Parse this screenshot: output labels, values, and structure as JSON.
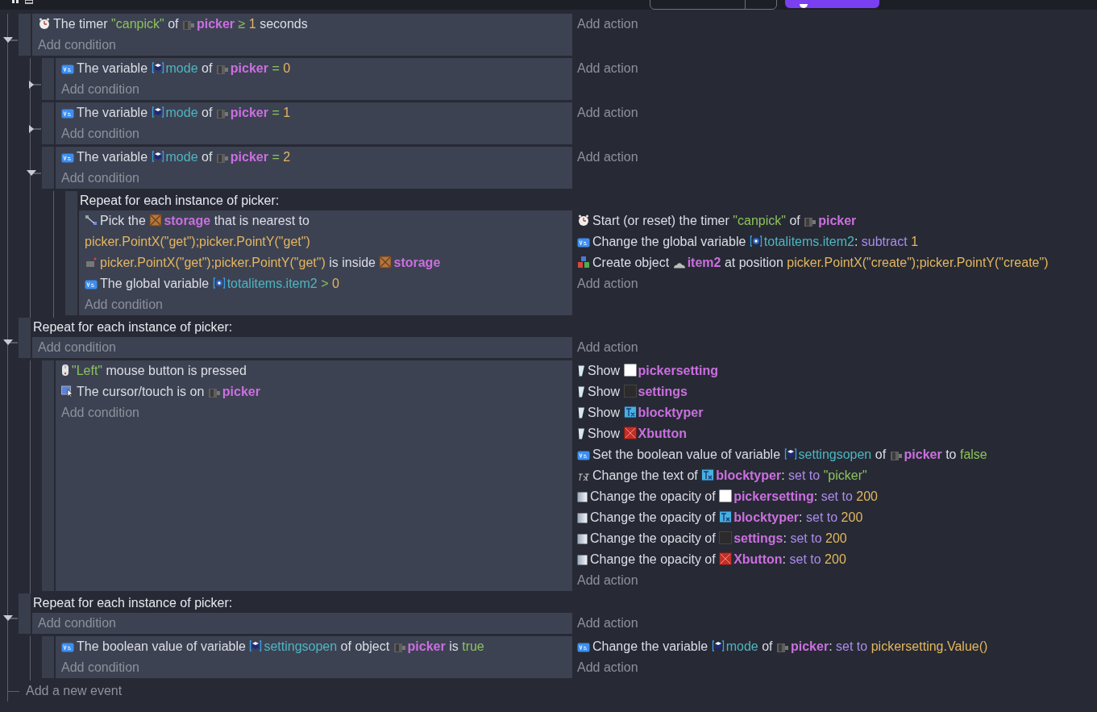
{
  "events": [
    {
      "kind": "standard",
      "expanded": true,
      "add_condition": "Add condition",
      "add_action": "Add action",
      "conditions": [
        {
          "kind": "timer",
          "parts": [
            {
              "kind": "text",
              "text": "The timer"
            },
            {
              "kind": "string",
              "text": "\"canpick\""
            },
            {
              "kind": "text",
              "text": "of"
            },
            {
              "kind": "sprite",
              "text": "picker"
            },
            {
              "kind": "operator",
              "text": "≥"
            },
            {
              "kind": "number",
              "text": "1"
            },
            {
              "kind": "text",
              "text": "seconds"
            }
          ]
        }
      ],
      "children": [
        {
          "kind": "standard",
          "expanded": false,
          "add_condition": "Add condition",
          "add_action": "Add action",
          "conditions": [
            {
              "kind": "variable",
              "parts": [
                {
                  "kind": "text",
                  "text": "The variable"
                },
                {
                  "kind": "objectvariable",
                  "text": "mode"
                },
                {
                  "kind": "text",
                  "text": "of"
                },
                {
                  "kind": "sprite",
                  "text": "picker"
                },
                {
                  "kind": "operator",
                  "text": "="
                },
                {
                  "kind": "number",
                  "text": "0"
                }
              ]
            }
          ]
        },
        {
          "kind": "standard",
          "expanded": false,
          "add_condition": "Add condition",
          "add_action": "Add action",
          "conditions": [
            {
              "kind": "variable",
              "parts": [
                {
                  "kind": "text",
                  "text": "The variable"
                },
                {
                  "kind": "objectvariable",
                  "text": "mode"
                },
                {
                  "kind": "text",
                  "text": "of"
                },
                {
                  "kind": "sprite",
                  "text": "picker"
                },
                {
                  "kind": "operator",
                  "text": "="
                },
                {
                  "kind": "number",
                  "text": "1"
                }
              ]
            }
          ]
        },
        {
          "kind": "standard",
          "expanded": true,
          "add_condition": "Add condition",
          "add_action": "Add action",
          "conditions": [
            {
              "kind": "variable",
              "parts": [
                {
                  "kind": "text",
                  "text": "The variable"
                },
                {
                  "kind": "objectvariable",
                  "text": "mode"
                },
                {
                  "kind": "text",
                  "text": "of"
                },
                {
                  "kind": "sprite",
                  "text": "picker"
                },
                {
                  "kind": "operator",
                  "text": "="
                },
                {
                  "kind": "number",
                  "text": "2"
                }
              ]
            }
          ],
          "children": [
            {
              "kind": "foreach",
              "header": "Repeat for each instance of picker:",
              "add_condition": "Add condition",
              "add_action": "Add action",
              "conditions": [
                {
                  "kind": "pick",
                  "parts": [
                    {
                      "kind": "text",
                      "text": "Pick the"
                    },
                    {
                      "kind": "crate",
                      "text": "storage"
                    },
                    {
                      "kind": "text",
                      "text": "that is nearest to"
                    },
                    {
                      "kind": "blockexpression",
                      "text": "picker.PointX(\"get\");picker.PointY(\"get\")"
                    }
                  ]
                },
                {
                  "kind": "point",
                  "parts": [
                    {
                      "kind": "expression",
                      "text": "picker.PointX(\"get\");picker.PointY(\"get\")"
                    },
                    {
                      "kind": "text",
                      "text": "is inside"
                    },
                    {
                      "kind": "crate",
                      "text": "storage"
                    }
                  ]
                },
                {
                  "kind": "variable",
                  "parts": [
                    {
                      "kind": "text",
                      "text": "The global variable"
                    },
                    {
                      "kind": "globalvariable",
                      "text": "totalitems.item2"
                    },
                    {
                      "kind": "operator",
                      "text": ">"
                    },
                    {
                      "kind": "number",
                      "text": "0"
                    }
                  ]
                }
              ],
              "actions": [
                {
                  "kind": "timer",
                  "parts": [
                    {
                      "kind": "text",
                      "text": "Start (or reset) the timer"
                    },
                    {
                      "kind": "string",
                      "text": "\"canpick\""
                    },
                    {
                      "kind": "text",
                      "text": "of"
                    },
                    {
                      "kind": "sprite",
                      "text": "picker"
                    }
                  ]
                },
                {
                  "kind": "variable",
                  "parts": [
                    {
                      "kind": "text",
                      "text": "Change the global variable"
                    },
                    {
                      "kind": "globalvariable",
                      "text": "totalitems.item2"
                    },
                    {
                      "kind": "colon",
                      "text": ":"
                    },
                    {
                      "kind": "keyword",
                      "text": "subtract"
                    },
                    {
                      "kind": "number",
                      "text": "1"
                    }
                  ]
                },
                {
                  "kind": "create",
                  "parts": [
                    {
                      "kind": "text",
                      "text": "Create object"
                    },
                    {
                      "kind": "cloud",
                      "text": "item2"
                    },
                    {
                      "kind": "text",
                      "text": "at position"
                    },
                    {
                      "kind": "expression",
                      "text": "picker.PointX(\"create\");picker.PointY(\"create\")"
                    }
                  ]
                }
              ]
            }
          ]
        }
      ]
    },
    {
      "kind": "foreach",
      "expanded": true,
      "header": "Repeat for each instance of picker:",
      "add_condition": "Add condition",
      "add_action": "Add action",
      "children": [
        {
          "kind": "standard",
          "add_condition": "Add condition",
          "add_action": "Add action",
          "conditions": [
            {
              "kind": "mouse",
              "parts": [
                {
                  "kind": "string",
                  "text": "\"Left\""
                },
                {
                  "kind": "text",
                  "text": "mouse button is pressed"
                }
              ]
            },
            {
              "kind": "cursor",
              "parts": [
                {
                  "kind": "text",
                  "text": "The cursor/touch is on"
                },
                {
                  "kind": "sprite",
                  "text": "picker"
                }
              ]
            }
          ],
          "actions": [
            {
              "kind": "show",
              "parts": [
                {
                  "kind": "text",
                  "text": "Show"
                },
                {
                  "kind": "panel",
                  "text": "pickersetting"
                }
              ]
            },
            {
              "kind": "show",
              "parts": [
                {
                  "kind": "text",
                  "text": "Show"
                },
                {
                  "kind": "darkpanel",
                  "text": "settings"
                }
              ]
            },
            {
              "kind": "show",
              "parts": [
                {
                  "kind": "text",
                  "text": "Show"
                },
                {
                  "kind": "textobject",
                  "text": "blocktyper"
                }
              ]
            },
            {
              "kind": "show",
              "parts": [
                {
                  "kind": "text",
                  "text": "Show"
                },
                {
                  "kind": "xbutton",
                  "text": "Xbutton"
                }
              ]
            },
            {
              "kind": "variable",
              "parts": [
                {
                  "kind": "text",
                  "text": "Set the boolean value of variable"
                },
                {
                  "kind": "objectvariable",
                  "text": "settingsopen"
                },
                {
                  "kind": "text",
                  "text": "of"
                },
                {
                  "kind": "sprite",
                  "text": "picker"
                },
                {
                  "kind": "text",
                  "text": "to"
                },
                {
                  "kind": "boolean",
                  "text": "false"
                }
              ]
            },
            {
              "kind": "textchange",
              "parts": [
                {
                  "kind": "text",
                  "text": "Change the text of"
                },
                {
                  "kind": "textobject",
                  "text": "blocktyper"
                },
                {
                  "kind": "colon",
                  "text": ":"
                },
                {
                  "kind": "keyword",
                  "text": "set to"
                },
                {
                  "kind": "string",
                  "text": "\"picker\""
                }
              ]
            },
            {
              "kind": "opacity",
              "parts": [
                {
                  "kind": "text",
                  "text": "Change the opacity of"
                },
                {
                  "kind": "panel",
                  "text": "pickersetting"
                },
                {
                  "kind": "colon",
                  "text": ":"
                },
                {
                  "kind": "keyword",
                  "text": "set to"
                },
                {
                  "kind": "number",
                  "text": "200"
                }
              ]
            },
            {
              "kind": "opacity",
              "parts": [
                {
                  "kind": "text",
                  "text": "Change the opacity of"
                },
                {
                  "kind": "textobject",
                  "text": "blocktyper"
                },
                {
                  "kind": "colon",
                  "text": ":"
                },
                {
                  "kind": "keyword",
                  "text": "set to"
                },
                {
                  "kind": "number",
                  "text": "200"
                }
              ]
            },
            {
              "kind": "opacity",
              "parts": [
                {
                  "kind": "text",
                  "text": "Change the opacity of"
                },
                {
                  "kind": "darkpanel",
                  "text": "settings"
                },
                {
                  "kind": "colon",
                  "text": ":"
                },
                {
                  "kind": "keyword",
                  "text": "set to"
                },
                {
                  "kind": "number",
                  "text": "200"
                }
              ]
            },
            {
              "kind": "opacity",
              "parts": [
                {
                  "kind": "text",
                  "text": "Change the opacity of"
                },
                {
                  "kind": "xbutton",
                  "text": "Xbutton"
                },
                {
                  "kind": "colon",
                  "text": ":"
                },
                {
                  "kind": "keyword",
                  "text": "set to"
                },
                {
                  "kind": "number",
                  "text": "200"
                }
              ]
            }
          ]
        }
      ]
    },
    {
      "kind": "foreach",
      "expanded": true,
      "header": "Repeat for each instance of picker:",
      "add_condition": "Add condition",
      "add_action": "Add action",
      "children": [
        {
          "kind": "standard",
          "add_condition": "Add condition",
          "add_action": "Add action",
          "conditions": [
            {
              "kind": "variable",
              "parts": [
                {
                  "kind": "text",
                  "text": "The boolean value of variable"
                },
                {
                  "kind": "objectvariable",
                  "text": "settingsopen"
                },
                {
                  "kind": "text",
                  "text": "of object"
                },
                {
                  "kind": "sprite",
                  "text": "picker"
                },
                {
                  "kind": "text",
                  "text": "is"
                },
                {
                  "kind": "boolean",
                  "text": "true"
                }
              ]
            }
          ],
          "actions": [
            {
              "kind": "variable",
              "parts": [
                {
                  "kind": "text",
                  "text": "Change the variable"
                },
                {
                  "kind": "objectvariable",
                  "text": "mode"
                },
                {
                  "kind": "text",
                  "text": "of"
                },
                {
                  "kind": "sprite",
                  "text": "picker"
                },
                {
                  "kind": "colon",
                  "text": ":"
                },
                {
                  "kind": "keyword",
                  "text": "set to"
                },
                {
                  "kind": "expression",
                  "text": "pickersetting.Value()"
                }
              ]
            }
          ]
        }
      ]
    }
  ],
  "add_event": "Add a new event"
}
